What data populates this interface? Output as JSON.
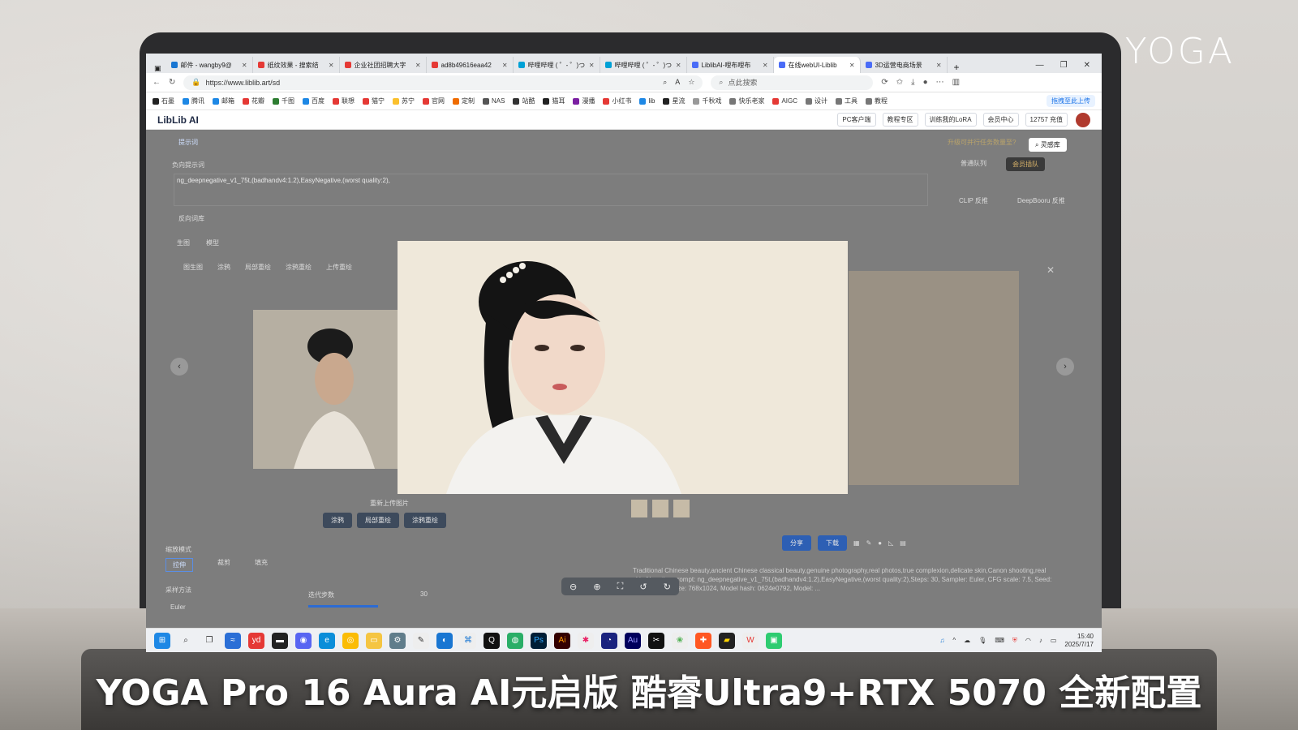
{
  "brand": "YOGA",
  "subtitle": "YOGA Pro 16 Aura AI元启版 酷睿Ultra9+RTX 5070 全新配置",
  "browser": {
    "tabs": [
      {
        "title": "邮件 - wangby9@",
        "active": false
      },
      {
        "title": "纸纹效果 - 搜索结",
        "active": false
      },
      {
        "title": "企业社团招聘大字",
        "active": false
      },
      {
        "title": "ad8b49616eaa42",
        "active": false
      },
      {
        "title": "哔哩哔哩 ( ゜- ゜)つ",
        "active": false
      },
      {
        "title": "哔哩哔哩 ( ゜- ゜)つ",
        "active": false
      },
      {
        "title": "LiblibAI-哩布哩布",
        "active": false
      },
      {
        "title": "在线webUI-Liblib",
        "active": true
      },
      {
        "title": "3D运营电商场景",
        "active": false
      }
    ],
    "url": "https://www.liblib.art/sd",
    "search_placeholder": "点此搜索",
    "bookmarks": [
      "石墨",
      "腾讯",
      "邮箱",
      "花瓣",
      "千图",
      "百度",
      "联想",
      "猫宁",
      "苏宁",
      "官网",
      "定制",
      "NAS",
      "站酷",
      "猫耳",
      "漫播",
      "小红书",
      "lib",
      "星流",
      "千秋戏",
      "快乐老家",
      "AIGC",
      "设计",
      "工具",
      "教程"
    ],
    "upload_label": "拖拽至此上传"
  },
  "app": {
    "logo": "LibLib AI",
    "header_buttons": [
      "PC客户端",
      "教程专区",
      "训练我的LoRA",
      "会员中心",
      "12757 充值"
    ],
    "prompt_label": "提示词",
    "negative_label": "负向提示词",
    "negative_text": "ng_deepnegative_v1_75t,(badhandv4:1.2),EasyNegative,(worst quality:2),",
    "reverse_label": "反向词库",
    "lingan_btn": "灵感库",
    "queue_label": "普通队列",
    "vip_queue": "会员插队",
    "clip_label": "CLIP 反推",
    "deepbooru_label": "DeepBooru 反推",
    "tabs_main": [
      "生图",
      "模型"
    ],
    "subtabs": [
      "图生图",
      "涂鸦",
      "局部重绘",
      "涂鸦重绘",
      "上传重绘"
    ],
    "upload_hint": "重新上传图片",
    "actions": [
      "涂鸦",
      "局部重绘",
      "涂鸦重绘"
    ],
    "zoom_mode": "缩放模式",
    "zoom_options": [
      "拉伸",
      "裁剪",
      "填充"
    ],
    "sampler_label": "采样方法",
    "sampler_value": "Euler",
    "steps_label": "迭代步数",
    "steps_value": "30",
    "share_btn": "分享",
    "download_btn": "下载",
    "result_text": "Traditional Chinese beauty,ancient Chinese classical beauty,genuine photography,real photos,true complexion,delicate skin,Canon shooting,real skin,Negative prompt: ng_deepnegative_v1_75t,(badhandv4:1.2),EasyNegative,(worst quality:2),Steps: 30, Sampler: Euler, CFG scale: 7.5, Seed: 4082011236, Size: 768x1024, Model hash: 0624e0792, Model: ...",
    "upgrade_hint": "升级可并行任务数量至?"
  },
  "taskbar": {
    "time": "15:40",
    "date": "2025/7/17"
  },
  "colors": {
    "accent": "#1a73e8",
    "overlay": "#7d7d7d"
  }
}
